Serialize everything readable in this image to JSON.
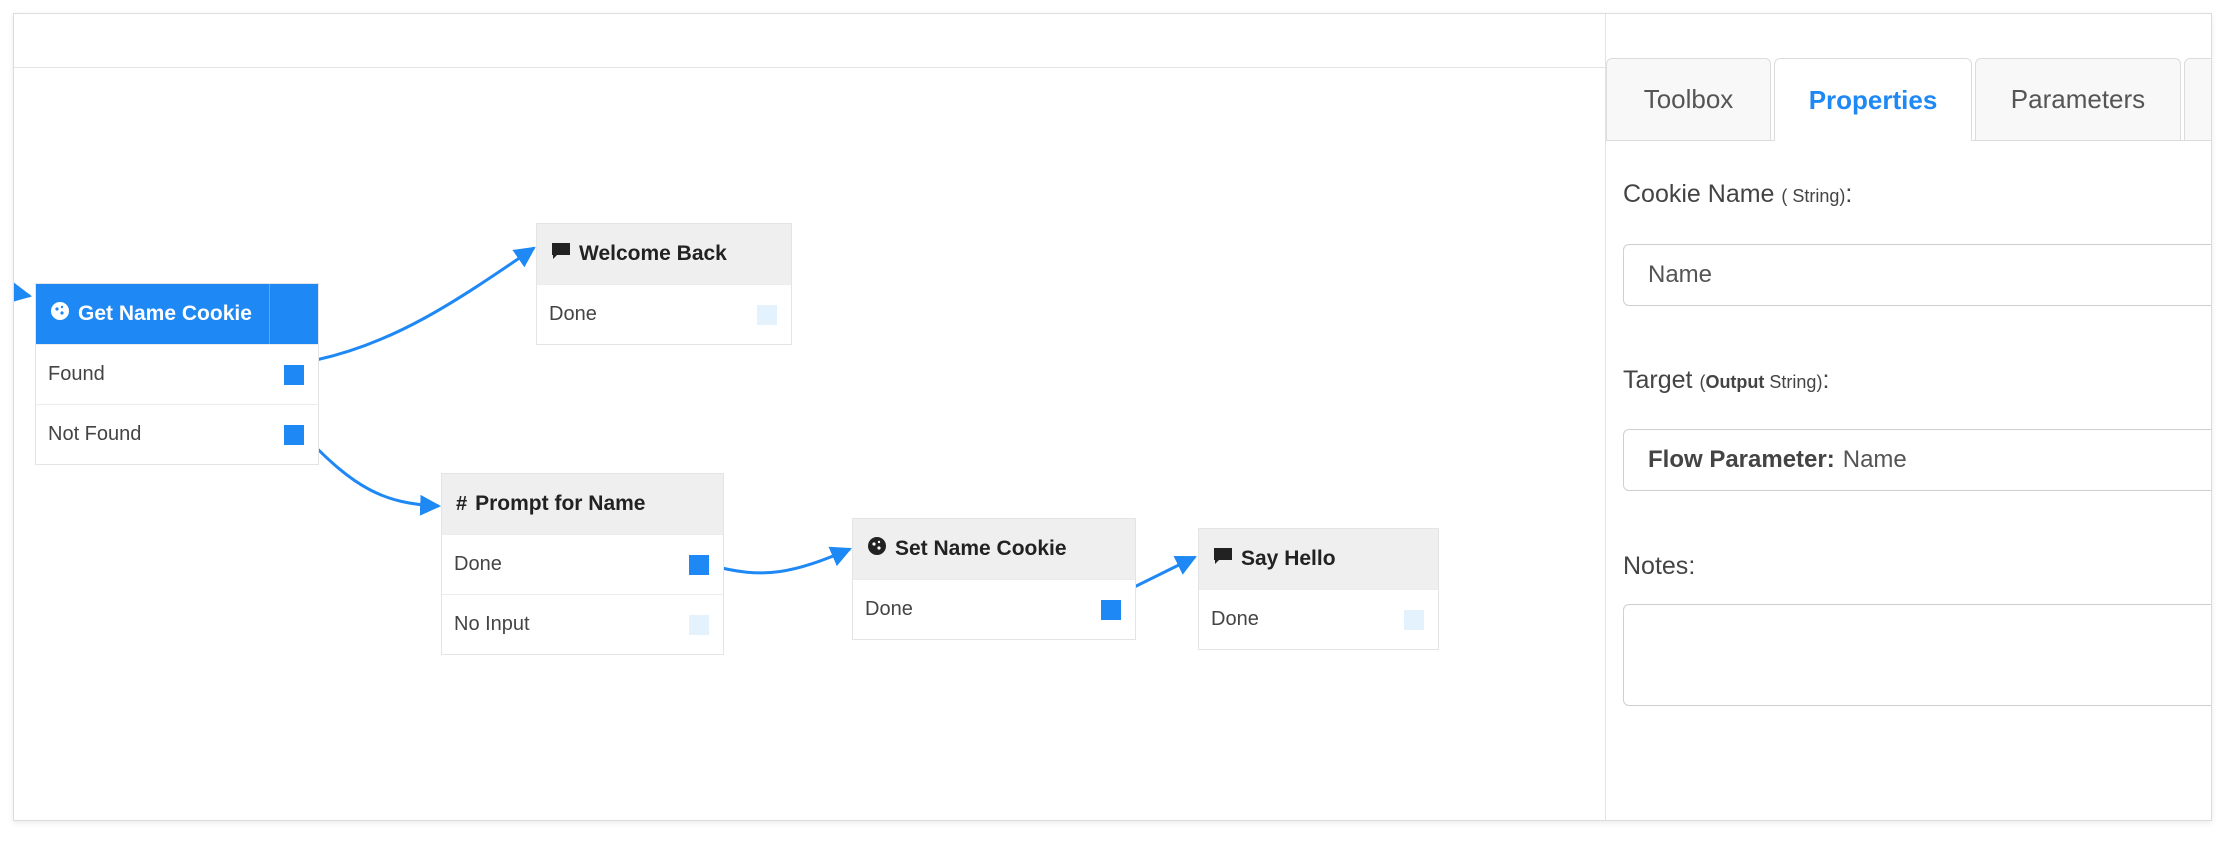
{
  "nodes": {
    "get_name_cookie": {
      "title": "Get Name Cookie",
      "rows": [
        "Found",
        "Not Found"
      ]
    },
    "welcome_back": {
      "title": "Welcome Back",
      "rows": [
        "Done"
      ]
    },
    "prompt_for_name": {
      "title": "Prompt for Name",
      "rows": [
        "Done",
        "No Input"
      ]
    },
    "set_name_cookie": {
      "title": "Set Name Cookie",
      "rows": [
        "Done"
      ]
    },
    "say_hello": {
      "title": "Say Hello",
      "rows": [
        "Done"
      ]
    }
  },
  "panel": {
    "tabs": [
      "Toolbox",
      "Properties",
      "Parameters"
    ],
    "active_tab": "Properties",
    "cookie_name": {
      "label": "Cookie Name",
      "type": "( String)",
      "colon": ":",
      "value": "Name"
    },
    "target": {
      "label": "Target",
      "type_open": "(",
      "type_bold": "Output",
      "type_rest": " String)",
      "colon": ":",
      "value_bold": "Flow Parameter:",
      "value": "Name"
    },
    "notes": {
      "label": "Notes",
      "colon": ":",
      "value": ""
    }
  },
  "colors": {
    "accent": "#1e88f5",
    "port_inactive": "#e3f2fd"
  },
  "icons": {
    "get_name_cookie": "cookie-icon",
    "welcome_back": "speech-bubble-icon",
    "prompt_for_name": "hash-icon",
    "set_name_cookie": "cookie-icon",
    "say_hello": "speech-bubble-icon"
  }
}
